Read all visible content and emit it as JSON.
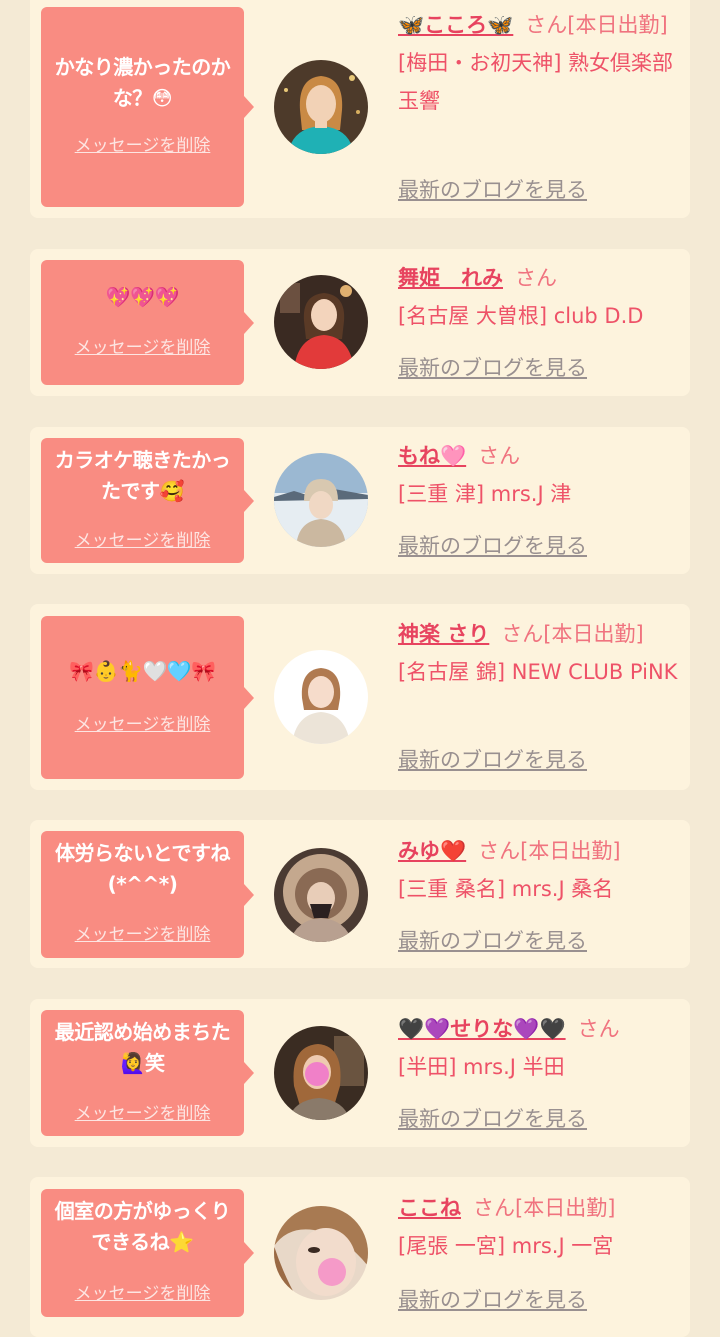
{
  "colors": {
    "page_bg": "#f4ead5",
    "card_bg": "#fdf3dd",
    "bubble_bg": "#f98c82",
    "name_color": "#e7435f",
    "link_gray": "#999090"
  },
  "cards": [
    {
      "message": "かなり濃かったのかな？😳",
      "delete_label": "メッセージを削除",
      "name": "🦋こころ🦋",
      "honorific": "さん[本日出勤]",
      "shop": "[梅田・お初天神] 熟女倶楽部 玉響",
      "blog_label": "最新のブログを見る",
      "avatar_icon": "woman-photo-teal-top"
    },
    {
      "message": "💖💖💖",
      "delete_label": "メッセージを削除",
      "name": "舞姫　れみ",
      "honorific": "さん",
      "shop": "[名古屋 大曽根] club D.D",
      "blog_label": "最新のブログを見る",
      "avatar_icon": "woman-photo-red-dress"
    },
    {
      "message": "カラオケ聴きたかったです🥰",
      "delete_label": "メッセージを削除",
      "name": "もね🩷",
      "honorific": "さん",
      "shop": "[三重 津] mrs.J 津",
      "blog_label": "最新のブログを見る",
      "avatar_icon": "woman-photo-snow"
    },
    {
      "message": "🎀👶🐈🤍🩵🎀",
      "delete_label": "メッセージを削除",
      "name": "神楽 さり",
      "honorific": "さん[本日出勤]",
      "shop": "[名古屋 錦] NEW CLUB PiNK",
      "blog_label": "最新のブログを見る",
      "avatar_icon": "woman-photo-white-top"
    },
    {
      "message": "体労らないとですね(*^^*)",
      "delete_label": "メッセージを削除",
      "name": "みゆ❤️",
      "honorific": "さん[本日出勤]",
      "shop": "[三重 桑名] mrs.J 桑名",
      "blog_label": "最新のブログを見る",
      "avatar_icon": "woman-photo-fur-hood"
    },
    {
      "message": "最近認め始めまちた🙋‍♀️笑",
      "delete_label": "メッセージを削除",
      "name": "🖤💜せりな💜🖤",
      "honorific": "さん",
      "shop": "[半田] mrs.J 半田",
      "blog_label": "最新のブログを見る",
      "avatar_icon": "woman-photo-face-hidden"
    },
    {
      "message": "個室の方がゆっくりできるね⭐",
      "delete_label": "メッセージを削除",
      "name": "ここね",
      "honorific": "さん[本日出勤]",
      "shop": "[尾張 一宮] mrs.J 一宮",
      "blog_label": "最新のブログを見る",
      "avatar_icon": "woman-photo-selfie"
    }
  ]
}
